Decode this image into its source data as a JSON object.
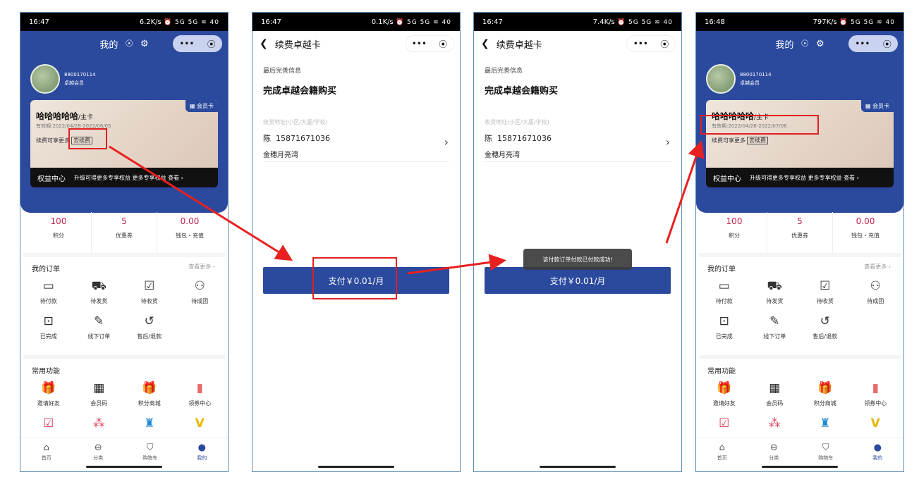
{
  "panels": [
    {
      "status": {
        "time": "16:47",
        "net": "6.2K/s",
        "icons": "⏰ 5G 5G ≋ 40"
      },
      "header": {
        "title": "我的"
      },
      "user": {
        "phone": "8800170114",
        "level": "卓越会员"
      },
      "card": {
        "badge": "会员卡",
        "name": "哈哈哈哈哈",
        "name_suffix": "/主卡",
        "valid": "有效期:2022/04/28-2022/06/05",
        "renew_text": "续费可享更多",
        "renew_btn": "去续费"
      },
      "rights": {
        "title": "权益中心",
        "text": "升级可得更多专享权益  更多专享权益 查看 ›"
      },
      "stats": [
        {
          "value": "100",
          "label": "积分"
        },
        {
          "value": "5",
          "label": "优惠券"
        },
        {
          "value": "0.00",
          "label": "钱包・充值"
        }
      ]
    },
    {
      "status": {
        "time": "16:47",
        "net": "0.1K/s",
        "icons": "⏰ 5G 5G ≋ 40"
      }
    },
    {
      "status": {
        "time": "16:47",
        "net": "7.4K/s",
        "icons": "⏰ 5G 5G ≋ 40"
      }
    },
    {
      "status": {
        "time": "16:48",
        "net": "797K/s",
        "icons": "⏰ 5G 5G ≋ 40"
      },
      "header": {
        "title": "我的"
      },
      "user": {
        "phone": "8800170114",
        "level": "卓越会员"
      },
      "card": {
        "badge": "会员卡",
        "name": "哈哈哈哈哈",
        "name_suffix": "/主卡",
        "valid": "有效期:2022/04/28-2022/07/06",
        "renew_text": "续费可享更多",
        "renew_btn": "去续费"
      },
      "rights": {
        "title": "权益中心",
        "text": "升级可得更多专享权益  更多专享权益 查看 ›"
      },
      "stats": [
        {
          "value": "100",
          "label": "积分"
        },
        {
          "value": "5",
          "label": "优惠券"
        },
        {
          "value": "0.00",
          "label": "钱包・充值"
        }
      ]
    }
  ],
  "orders": {
    "title": "我的订单",
    "more": "查看更多 ›",
    "items": [
      {
        "icon": "wallet-icon",
        "glyph": "▭",
        "label": "待付款"
      },
      {
        "icon": "truck-icon",
        "glyph": "⛟",
        "label": "待发货"
      },
      {
        "icon": "receive-box-icon",
        "glyph": "☑",
        "label": "待收货"
      },
      {
        "icon": "group-icon",
        "glyph": "⚇",
        "label": "待成团"
      },
      {
        "icon": "completed-icon",
        "glyph": "⊡",
        "label": "已完成"
      },
      {
        "icon": "offline-order-icon",
        "glyph": "✎",
        "label": "线下订单"
      },
      {
        "icon": "refund-icon",
        "glyph": "↺",
        "label": "售后/退款"
      }
    ]
  },
  "functions": {
    "title": "常用功能",
    "items": [
      {
        "icon": "invite-icon",
        "glyph": "🎁",
        "label": "邀请好友",
        "color": "#3d7de0"
      },
      {
        "icon": "qr-code-icon",
        "glyph": "▦",
        "label": "会员码",
        "color": "#222222"
      },
      {
        "icon": "points-mall-icon",
        "glyph": "🎁",
        "label": "积分商城",
        "color": "#f0a020"
      },
      {
        "icon": "coupon-center-icon",
        "glyph": "▮",
        "label": "领券中心",
        "color": "#e86a6a"
      }
    ],
    "row2": [
      {
        "icon": "calendar-check-icon",
        "glyph": "☑",
        "color": "#e0405a"
      },
      {
        "icon": "distribution-icon",
        "glyph": "⁂",
        "color": "#e0405a"
      },
      {
        "icon": "group-bag-icon",
        "glyph": "♜",
        "color": "#1e88d0"
      },
      {
        "icon": "vip-v-icon",
        "glyph": "V",
        "color": "#e8b800"
      }
    ]
  },
  "tabbar": [
    {
      "icon": "home-icon",
      "glyph": "⌂",
      "label": "首页"
    },
    {
      "icon": "category-icon",
      "glyph": "⊖",
      "label": "分类"
    },
    {
      "icon": "cart-icon",
      "glyph": "⛉",
      "label": "购物车"
    },
    {
      "icon": "user-icon",
      "glyph": "●",
      "label": "我的",
      "active": true
    }
  ],
  "renew": {
    "title": "续费卓越卡",
    "last_info": "最后完善信息",
    "complete": "完成卓越会籍购买",
    "addr_label": "收货地址(小区/大厦/学校)",
    "contact_name": "陈",
    "contact_phone": "15871671036",
    "address": "金穗月亮湾",
    "pay": "支付￥0.01/月"
  },
  "toast": "该付款订单付款已付款成功!",
  "capsule": {
    "more": "•••",
    "target": "⦿"
  }
}
